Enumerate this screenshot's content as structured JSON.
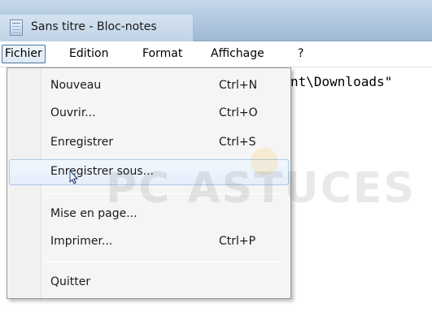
{
  "window": {
    "title": "Sans titre - Bloc-notes",
    "icon": "notepad-icon"
  },
  "menubar": {
    "items": [
      {
        "label": "Fichier",
        "active": true
      },
      {
        "label": "Edition",
        "active": false
      },
      {
        "label": "Format",
        "active": false
      },
      {
        "label": "Affichage",
        "active": false
      },
      {
        "label": "?",
        "active": false
      }
    ]
  },
  "editor": {
    "visible_text": "nt\\Downloads\""
  },
  "file_menu": {
    "items": [
      {
        "label": "Nouveau",
        "shortcut": "Ctrl+N"
      },
      {
        "label": "Ouvrir...",
        "shortcut": "Ctrl+O"
      },
      {
        "label": "Enregistrer",
        "shortcut": "Ctrl+S"
      },
      {
        "label": "Enregistrer sous...",
        "shortcut": "",
        "hovered": true
      },
      {
        "label": "Mise en page...",
        "shortcut": ""
      },
      {
        "label": "Imprimer...",
        "shortcut": "Ctrl+P"
      },
      {
        "label": "Quitter",
        "shortcut": ""
      }
    ]
  },
  "watermark": {
    "text": "PC ASTUCES"
  },
  "colors": {
    "title_bar": "#b2c9e0",
    "menu_highlight_border": "#a8c8ec",
    "menu_background": "#f5f5f5"
  }
}
